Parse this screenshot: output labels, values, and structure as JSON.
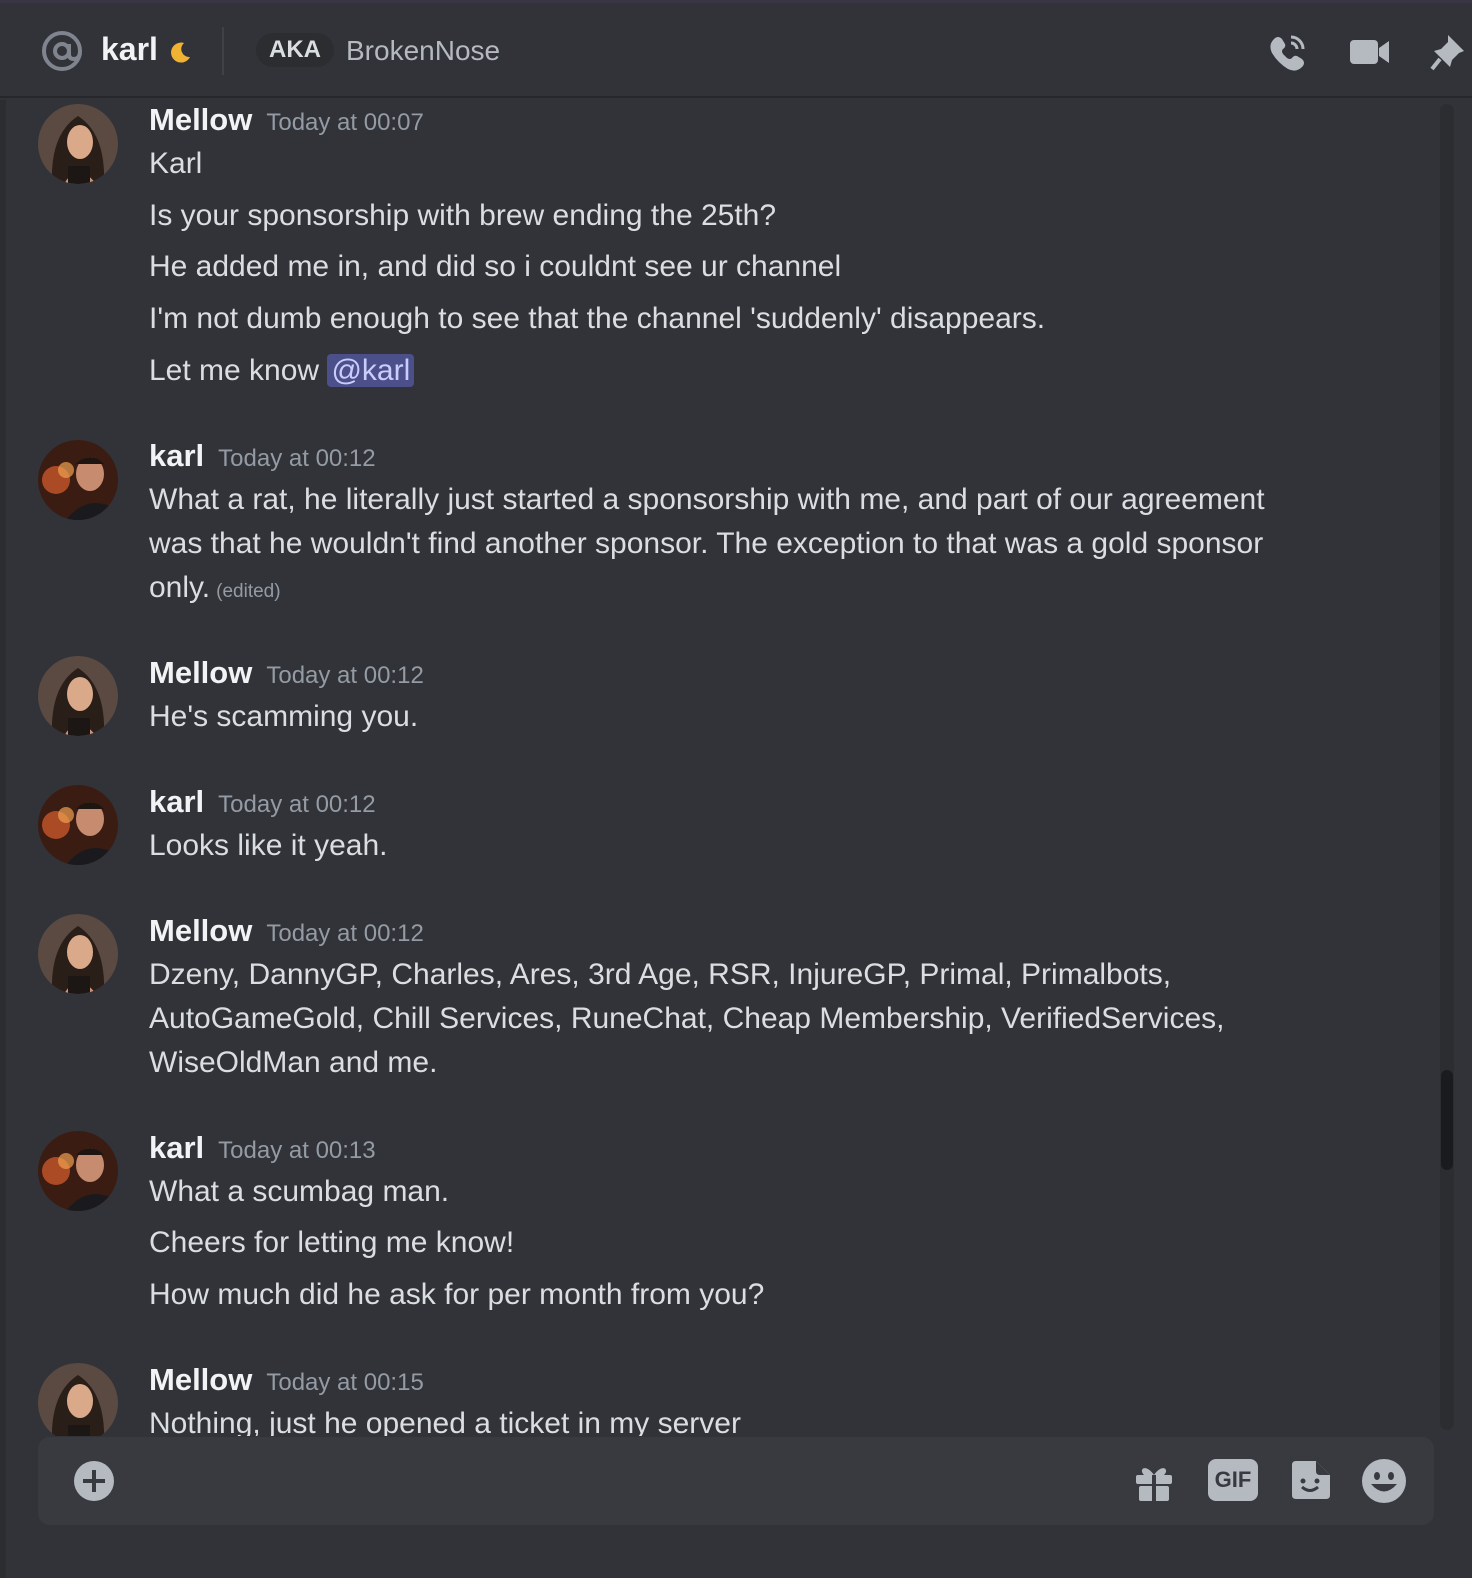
{
  "header": {
    "username": "karl",
    "status": "idle-moon-icon",
    "aka_label": "AKA",
    "aka_name": "BrokenNose"
  },
  "messages": [
    {
      "author": "Mellow",
      "time": "Today at 00:07",
      "lines": [
        "Karl",
        "Is your sponsorship with brew ending the 25th?",
        "He added me in, and did so i couldnt see ur channel",
        "I'm not dumb enough to see that the channel 'suddenly' disappears.",
        "Let me know"
      ],
      "mention": "@karl"
    },
    {
      "author": "karl",
      "time": "Today at 00:12",
      "text": "What a rat, he literally just started a sponsorship with me, and part of our agreement was that he wouldn't find another sponsor. The exception to that was a gold sponsor only.",
      "edited": "(edited)"
    },
    {
      "author": "Mellow",
      "time": "Today at 00:12",
      "lines": [
        "He's scamming you."
      ]
    },
    {
      "author": "karl",
      "time": "Today at 00:12",
      "lines": [
        "Looks like it yeah."
      ]
    },
    {
      "author": "Mellow",
      "time": "Today at 00:12",
      "text": "Dzeny, DannyGP, Charles, Ares, 3rd Age, RSR, InjureGP, Primal, Primalbots, AutoGameGold, Chill Services, RuneChat, Cheap Membership, VerifiedServices, WiseOldMan and me."
    },
    {
      "author": "karl",
      "time": "Today at 00:13",
      "lines": [
        "What a scumbag man.",
        "Cheers for letting me know!",
        "How much did he ask for per month from you?"
      ]
    },
    {
      "author": "Mellow",
      "time": "Today at 00:15",
      "lines": [
        "Nothing, just he opened a ticket in my server"
      ]
    }
  ],
  "composer": {
    "icons": [
      "add-attachment-icon",
      "gift-icon",
      "gif-icon",
      "sticker-icon",
      "emoji-icon"
    ],
    "gif_label": "GIF"
  },
  "colors": {
    "background": "#313338",
    "composer": "#383a40",
    "mention_bg": "#4b4f8a",
    "idle": "#f0b232"
  }
}
